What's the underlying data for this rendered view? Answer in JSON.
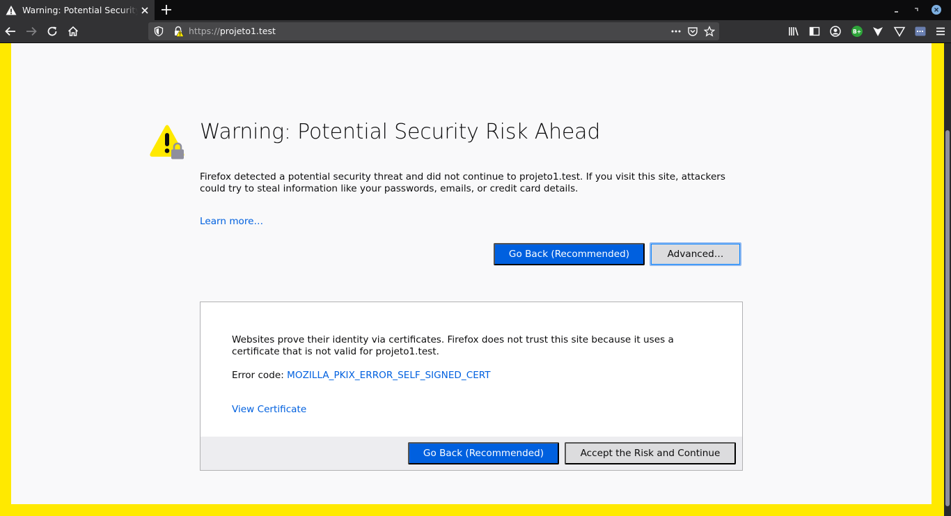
{
  "browser": {
    "tab_title": "Warning: Potential Security Risk Ahead",
    "url_scheme": "https://",
    "url_host": "projeto1.test",
    "extension_badge": "B+"
  },
  "page": {
    "title": "Warning: Potential Security Risk Ahead",
    "description": "Firefox detected a potential security threat and did not continue to projeto1.test. If you visit this site, attackers could try to steal information like your passwords, emails, or credit card details.",
    "learn_more": "Learn more…",
    "go_back": "Go Back (Recommended)",
    "advanced": "Advanced…"
  },
  "advanced_panel": {
    "text": "Websites prove their identity via certificates. Firefox does not trust this site because it uses a certificate that is not valid for projeto1.test.",
    "error_code_label": "Error code: ",
    "error_code": "MOZILLA_PKIX_ERROR_SELF_SIGNED_CERT",
    "view_certificate": "View Certificate",
    "go_back": "Go Back (Recommended)",
    "accept_risk": "Accept the Risk and Continue"
  },
  "colors": {
    "accent_blue": "#0060df",
    "frame_yellow": "#ffe900",
    "warning_yellow": "#ffe900"
  }
}
